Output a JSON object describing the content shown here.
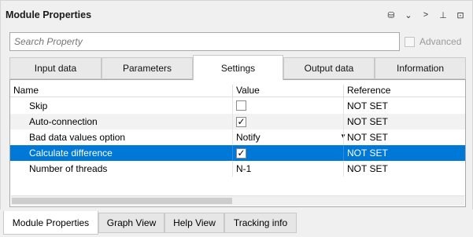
{
  "panel": {
    "title": "Module Properties",
    "icons": [
      "database-settings-icon",
      "chevron-down-icon",
      "chevron-right-icon",
      "pin-icon",
      "maximize-icon"
    ],
    "icon_glyphs": [
      "⛁",
      "⌄",
      ">",
      "⊥",
      "⊡"
    ]
  },
  "search": {
    "placeholder": "Search Property"
  },
  "advanced": {
    "label": "Advanced",
    "checked": false
  },
  "tabs": [
    {
      "label": "Input data",
      "active": false
    },
    {
      "label": "Parameters",
      "active": false
    },
    {
      "label": "Settings",
      "active": true
    },
    {
      "label": "Output data",
      "active": false
    },
    {
      "label": "Information",
      "active": false
    }
  ],
  "grid": {
    "columns": [
      "Name",
      "Value",
      "Reference"
    ],
    "rows": [
      {
        "name": "Skip",
        "value_type": "checkbox",
        "checked": false,
        "check_glyph": "",
        "reference": "NOT SET"
      },
      {
        "name": "Auto-connection",
        "value_type": "checkbox",
        "checked": true,
        "check_glyph": "✓",
        "reference": "NOT SET"
      },
      {
        "name": "Bad data values option",
        "value_type": "dropdown",
        "value": "Notify",
        "dropdown_glyph": "▼",
        "reference": "NOT SET"
      },
      {
        "name": "Calculate difference",
        "value_type": "checkbox",
        "checked": true,
        "check_glyph": "✓",
        "reference": "NOT SET",
        "selected": true
      },
      {
        "name": "Number of threads",
        "value_type": "text",
        "value": "N-1",
        "reference": "NOT SET"
      }
    ]
  },
  "bottom_tabs": [
    {
      "label": "Module Properties",
      "active": true
    },
    {
      "label": "Graph View",
      "active": false
    },
    {
      "label": "Help View",
      "active": false
    },
    {
      "label": "Tracking info",
      "active": false
    }
  ],
  "colors": {
    "selection": "#0078d7",
    "panel_bg": "#f0f0f0"
  }
}
